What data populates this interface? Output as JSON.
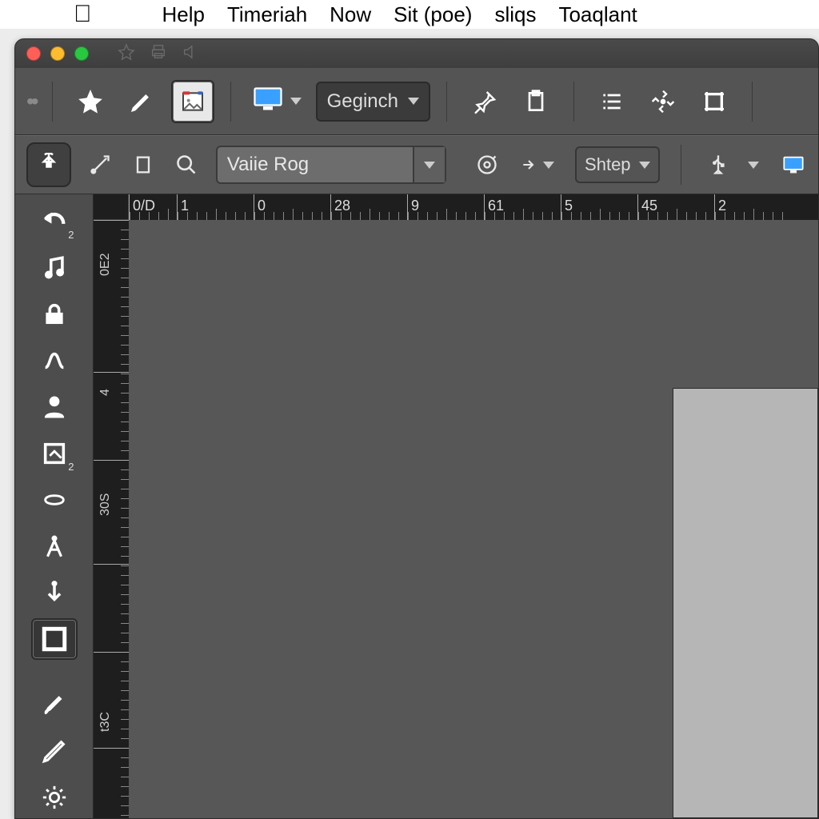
{
  "mac_menu": {
    "items": [
      "Help",
      "Timeriah",
      "Now",
      "Sit (poe)",
      "sliqs",
      "Toaqlant"
    ]
  },
  "toolbar1": {
    "display_label": "",
    "zoom_label": "Geginch"
  },
  "toolbar2": {
    "combo_value": "Vaiie Rog",
    "step_label": "Shtep"
  },
  "ruler_h": {
    "labels": [
      "0/D",
      "1",
      "0",
      "28",
      "9",
      "61",
      "5",
      "45",
      "2"
    ]
  },
  "ruler_v": {
    "labels": [
      "0E2",
      "4",
      "30S",
      "t3C"
    ]
  },
  "tools": {
    "sub_undo": "2",
    "sub_edit": "2"
  }
}
